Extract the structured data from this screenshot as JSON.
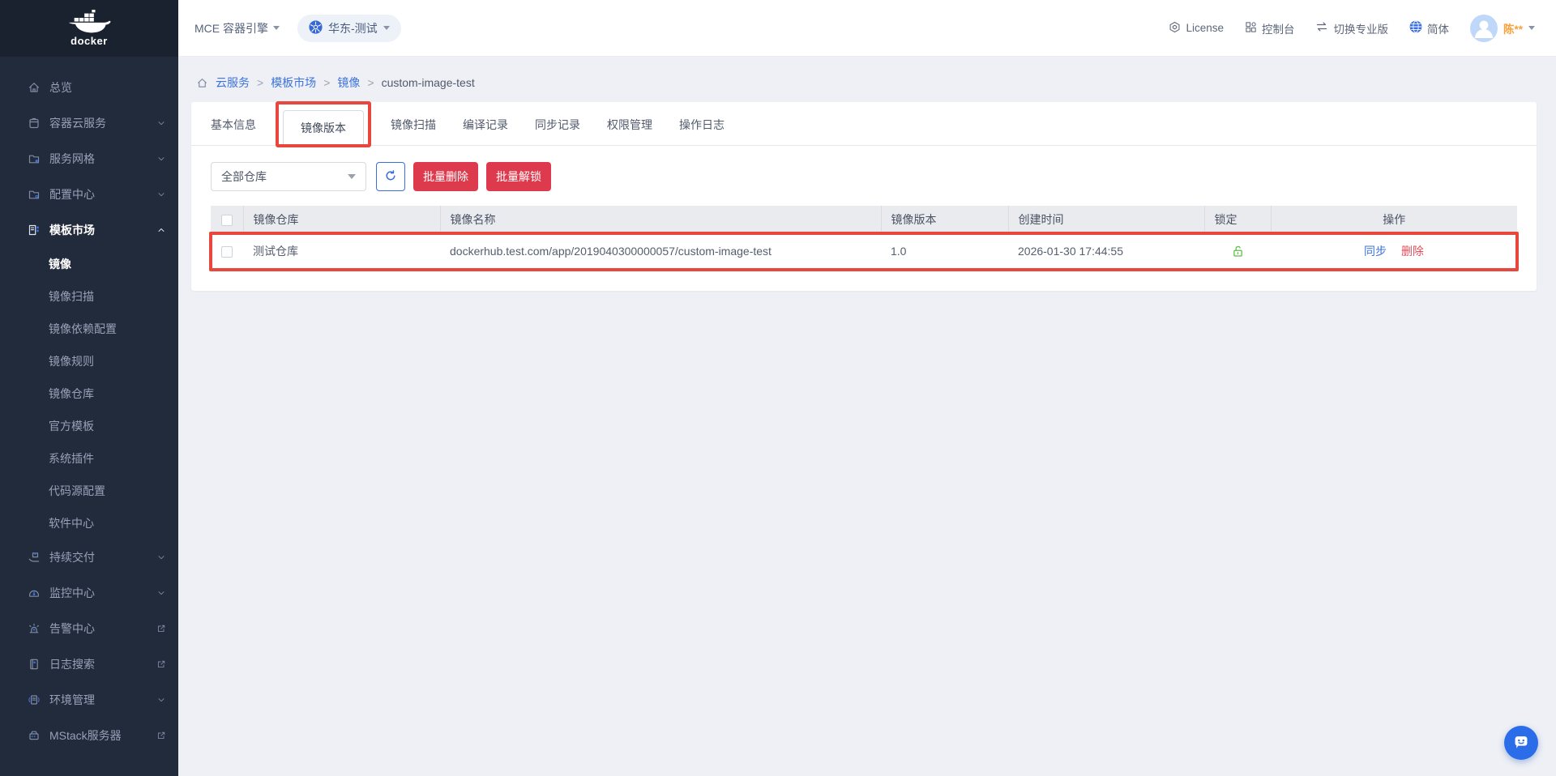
{
  "brand": {
    "logo_text": "docker"
  },
  "navbar": {
    "product": "MCE 容器引擎",
    "cluster": "华东-测试",
    "license": "License",
    "console": "控制台",
    "switch_pro": "切换专业版",
    "language": "简体",
    "username": "陈**"
  },
  "sidebar": {
    "items": [
      {
        "label": "总览"
      },
      {
        "label": "容器云服务"
      },
      {
        "label": "服务网格"
      },
      {
        "label": "配置中心"
      },
      {
        "label": "模板市场"
      },
      {
        "label": "持续交付"
      },
      {
        "label": "监控中心"
      },
      {
        "label": "告警中心"
      },
      {
        "label": "日志搜索"
      },
      {
        "label": "环境管理"
      },
      {
        "label": "MStack服务器"
      }
    ],
    "submenu": [
      "镜像",
      "镜像扫描",
      "镜像依赖配置",
      "镜像规则",
      "镜像仓库",
      "官方模板",
      "系统插件",
      "代码源配置",
      "软件中心"
    ]
  },
  "breadcrumb": {
    "items": [
      "云服务",
      "模板市场",
      "镜像",
      "custom-image-test"
    ],
    "separator": ">"
  },
  "tabs": {
    "items": [
      "基本信息",
      "镜像版本",
      "镜像扫描",
      "编译记录",
      "同步记录",
      "权限管理",
      "操作日志"
    ],
    "active": "镜像版本"
  },
  "toolbar": {
    "repo_filter_value": "全部仓库",
    "batch_delete": "批量删除",
    "batch_unlock": "批量解锁"
  },
  "table": {
    "columns": {
      "repo": "镜像仓库",
      "name": "镜像名称",
      "version": "镜像版本",
      "created": "创建时间",
      "lock": "锁定",
      "actions": "操作"
    },
    "rows": [
      {
        "repo": "测试仓库",
        "name": "dockerhub.test.com/app/2019040300000057/custom-image-test",
        "version": "1.0",
        "created": "2026-01-30 17:44:55",
        "lock_state": "unlocked",
        "action_sync": "同步",
        "action_delete": "删除"
      }
    ]
  },
  "colors": {
    "accent_blue": "#3a6ee0",
    "danger_red": "#dd3b4d",
    "annotation_red": "#e8473e",
    "lock_green": "#5cbf48",
    "username_orange": "#f9a13a",
    "sidebar_bg": "#222b3b"
  }
}
